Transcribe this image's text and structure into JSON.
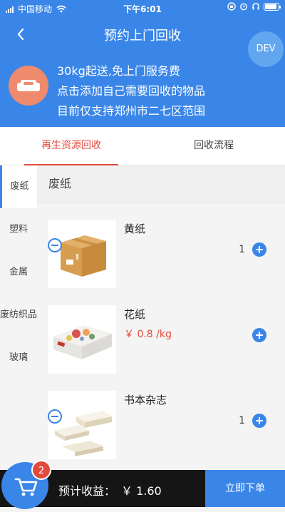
{
  "status": {
    "carrier": "中国移动",
    "time": "下午6:01",
    "battery_level": 0.9
  },
  "header": {
    "title": "预约上门回收",
    "dev_badge": "DEV",
    "info": [
      "30kg起送,免上门服务费",
      "点击添加自己需要回收的物品",
      "目前仅支持郑州市二七区范围"
    ]
  },
  "tabs": {
    "active": "再生资源回收",
    "second": "回收流程"
  },
  "sidebar": {
    "items": [
      {
        "label": "废纸"
      },
      {
        "label": "塑料"
      },
      {
        "label": "金属"
      },
      {
        "label": "废纺织品"
      },
      {
        "label": "玻璃"
      }
    ]
  },
  "content": {
    "category_title": "废纸",
    "products": [
      {
        "name": "黄纸",
        "price": "",
        "qty": "1"
      },
      {
        "name": "花纸",
        "price": "￥ 0.8 /kg",
        "qty": ""
      },
      {
        "name": "书本杂志",
        "price": "",
        "qty": "1"
      }
    ]
  },
  "bottom": {
    "cart_count": "2",
    "earnings_label": "预计收益：",
    "earnings_value": "￥ 1.60",
    "order_button": "立即下单"
  },
  "colors": {
    "primary": "#3a86e8",
    "accent": "#e24a3b",
    "dark": "#151515"
  }
}
